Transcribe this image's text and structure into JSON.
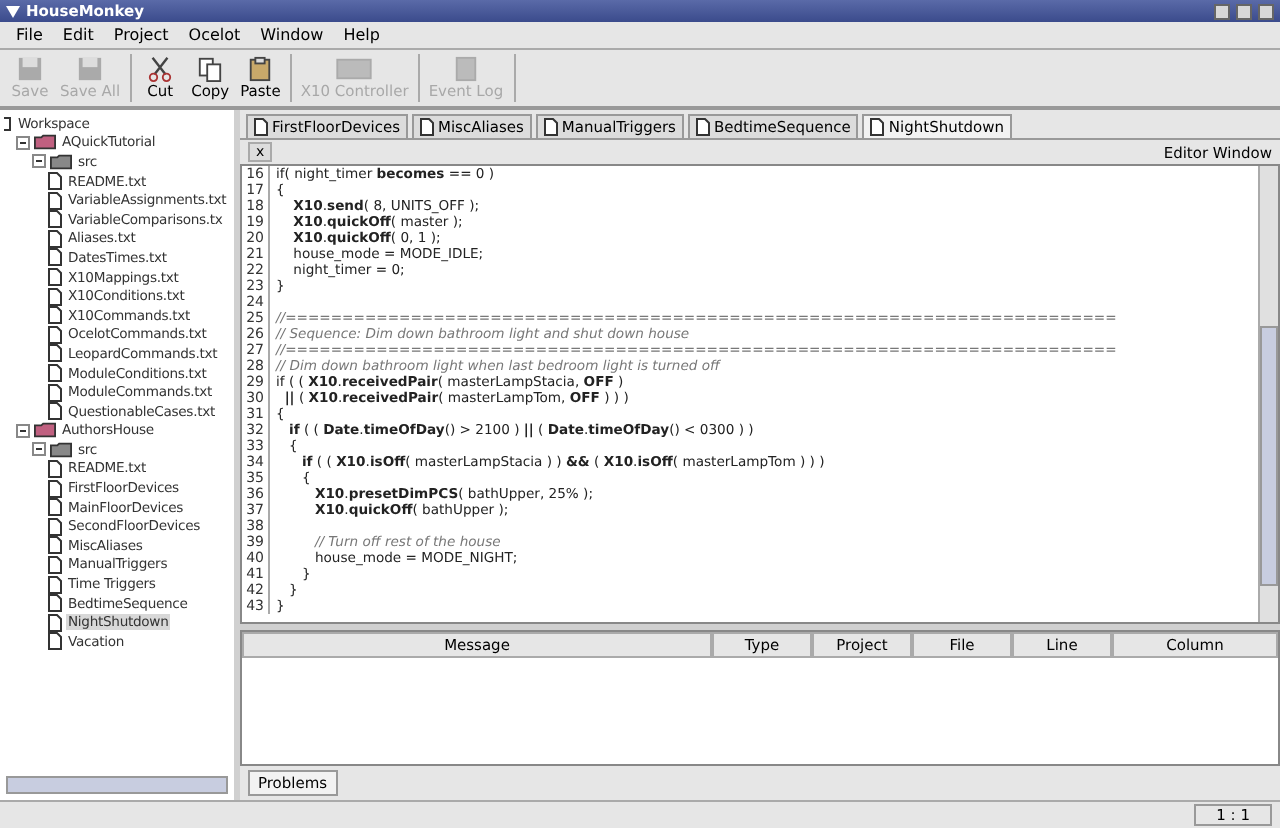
{
  "window": {
    "title": "HouseMonkey"
  },
  "menu": [
    "File",
    "Edit",
    "Project",
    "Ocelot",
    "Window",
    "Help"
  ],
  "toolbar": [
    {
      "label": "Save",
      "kind": "save",
      "disabled": true
    },
    {
      "label": "Save All",
      "kind": "saveall",
      "disabled": true
    },
    {
      "label": "Cut",
      "kind": "cut",
      "disabled": false
    },
    {
      "label": "Copy",
      "kind": "copy",
      "disabled": false
    },
    {
      "label": "Paste",
      "kind": "paste",
      "disabled": false
    },
    {
      "label": "X10 Controller",
      "kind": "controller",
      "disabled": true
    },
    {
      "label": "Event Log",
      "kind": "log",
      "disabled": true
    }
  ],
  "tree": {
    "label": "Workspace",
    "children": [
      {
        "label": "AQuickTutorial",
        "kind": "project",
        "expanded": true,
        "children": [
          {
            "label": "src",
            "kind": "folder",
            "expanded": true,
            "children": [
              {
                "label": "README.txt",
                "selected": false
              },
              {
                "label": "VariableAssignments.txt",
                "selected": false
              },
              {
                "label": "VariableComparisons.tx",
                "selected": false
              },
              {
                "label": "Aliases.txt",
                "selected": false
              },
              {
                "label": "DatesTimes.txt",
                "selected": false
              },
              {
                "label": "X10Mappings.txt",
                "selected": false
              },
              {
                "label": "X10Conditions.txt",
                "selected": false
              },
              {
                "label": "X10Commands.txt",
                "selected": false
              },
              {
                "label": "OcelotCommands.txt",
                "selected": false
              },
              {
                "label": "LeopardCommands.txt",
                "selected": false
              },
              {
                "label": "ModuleConditions.txt",
                "selected": false
              },
              {
                "label": "ModuleCommands.txt",
                "selected": false
              },
              {
                "label": "QuestionableCases.txt",
                "selected": false
              }
            ]
          }
        ]
      },
      {
        "label": "AuthorsHouse",
        "kind": "project",
        "expanded": true,
        "children": [
          {
            "label": "src",
            "kind": "folder",
            "expanded": true,
            "children": [
              {
                "label": "README.txt",
                "selected": false
              },
              {
                "label": "FirstFloorDevices",
                "selected": false
              },
              {
                "label": "MainFloorDevices",
                "selected": false
              },
              {
                "label": "SecondFloorDevices",
                "selected": false
              },
              {
                "label": "MiscAliases",
                "selected": false
              },
              {
                "label": "ManualTriggers",
                "selected": false
              },
              {
                "label": "Time Triggers",
                "selected": false
              },
              {
                "label": "BedtimeSequence",
                "selected": false
              },
              {
                "label": "NightShutdown",
                "selected": true
              },
              {
                "label": "Vacation",
                "selected": false
              }
            ]
          }
        ]
      }
    ]
  },
  "tabs": [
    {
      "label": "FirstFloorDevices",
      "selected": false
    },
    {
      "label": "MiscAliases",
      "selected": false
    },
    {
      "label": "ManualTriggers",
      "selected": false
    },
    {
      "label": "BedtimeSequence",
      "selected": false
    },
    {
      "label": "NightShutdown",
      "selected": true
    }
  ],
  "close_tab": "x",
  "editor_title": "Editor Window",
  "code": [
    {
      "num": "16",
      "text": "if( night_timer **becomes** == 0 )",
      "kind": "code"
    },
    {
      "num": "17",
      "text": "{",
      "kind": "code"
    },
    {
      "num": "18",
      "text": "    **X10**.**send**( 8, UNITS_OFF );",
      "kind": "code"
    },
    {
      "num": "19",
      "text": "    **X10**.**quickOff**( master );",
      "kind": "code"
    },
    {
      "num": "20",
      "text": "    **X10**.**quickOff**( 0, 1 );",
      "kind": "code"
    },
    {
      "num": "21",
      "text": "    house_mode = MODE_IDLE;",
      "kind": "code"
    },
    {
      "num": "22",
      "text": "    night_timer = 0;",
      "kind": "code"
    },
    {
      "num": "23",
      "text": "}",
      "kind": "code"
    },
    {
      "num": "24"
    },
    {
      "num": "25",
      "text": "//=========================================================================",
      "kind": "comment"
    },
    {
      "num": "26",
      "text": "// Sequence: Dim down bathroom light and shut down house",
      "kind": "comment"
    },
    {
      "num": "27",
      "text": "//=========================================================================",
      "kind": "comment"
    },
    {
      "num": "28",
      "text": "// Dim down bathroom light when last bedroom light is turned off",
      "kind": "comment"
    },
    {
      "num": "29",
      "text": "if ( ( **X10**.**receivedPair**( masterLampStacia, **OFF** )",
      "kind": "code"
    },
    {
      "num": "30",
      "text": "  **||** ( **X10**.**receivedPair**( masterLampTom, **OFF** ) ) )",
      "kind": "code"
    },
    {
      "num": "31",
      "text": "{",
      "kind": "code"
    },
    {
      "num": "32",
      "text": "   **if** ( ( **Date**.**timeOfDay**() > 2100 ) **||** ( **Date**.**timeOfDay**() < 0300 ) )",
      "kind": "code"
    },
    {
      "num": "33",
      "text": "   {",
      "kind": "code"
    },
    {
      "num": "34",
      "text": "      **if** ( ( **X10**.**isOff**( masterLampStacia ) ) **&&** ( **X10**.**isOff**( masterLampTom ) ) )",
      "kind": "code"
    },
    {
      "num": "35",
      "text": "      {",
      "kind": "code"
    },
    {
      "num": "36",
      "text": "         **X10**.**presetDimPCS**( bathUpper, 25% );",
      "kind": "code"
    },
    {
      "num": "37",
      "text": "         **X10**.**quickOff**( bathUpper );",
      "kind": "code"
    },
    {
      "num": "38"
    },
    {
      "num": "39",
      "text": "         // Turn off rest of the house",
      "kind": "comment"
    },
    {
      "num": "40",
      "text": "         house_mode = MODE_NIGHT;",
      "kind": "code"
    },
    {
      "num": "41",
      "text": "      }",
      "kind": "code"
    },
    {
      "num": "42",
      "text": "   }",
      "kind": "code"
    },
    {
      "num": "43",
      "text": "}",
      "kind": "code"
    }
  ],
  "problems": {
    "columns": [
      "Message",
      "Type",
      "Project",
      "File",
      "Line",
      "Column"
    ],
    "tab": "Problems"
  },
  "status_bar": {
    "position": "1 : 1"
  }
}
